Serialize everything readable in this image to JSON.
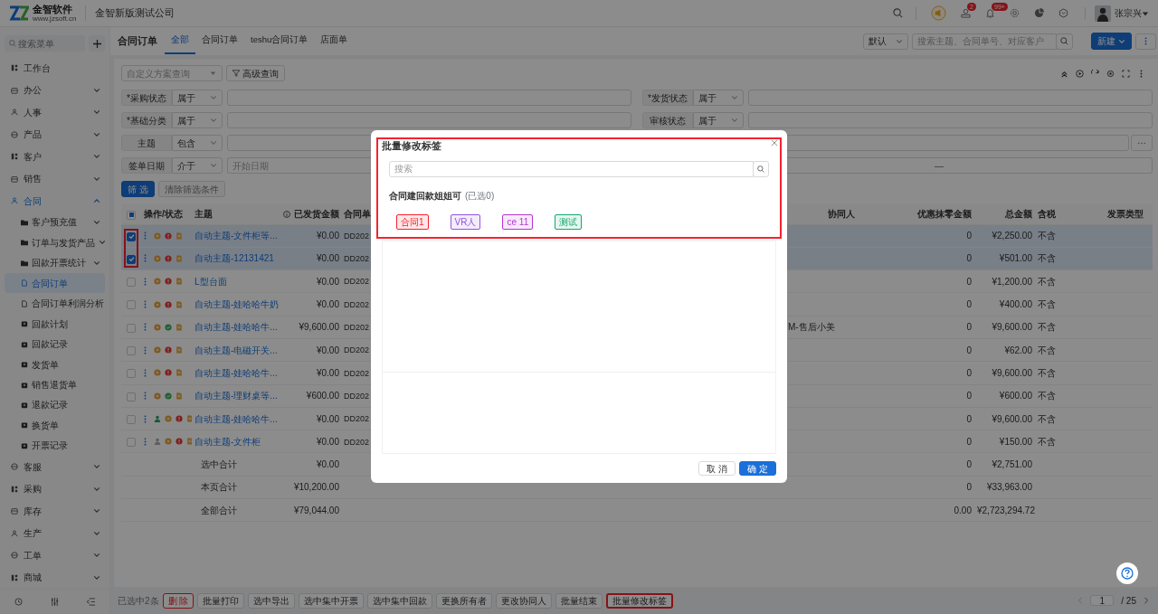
{
  "header": {
    "logo_name": "金智软件",
    "logo_url": "www.jzsoft.cn",
    "company": "金智新版测试公司",
    "badges": [
      "2",
      "99+"
    ],
    "user": "张宗兴"
  },
  "sidebar": {
    "search_placeholder": "搜索菜单",
    "items": [
      {
        "label": "工作台",
        "selected": false
      },
      {
        "label": "办公",
        "selected": false,
        "expanded": false
      },
      {
        "label": "人事",
        "selected": false,
        "expanded": false
      },
      {
        "label": "产品",
        "selected": false,
        "expanded": false
      },
      {
        "label": "客户",
        "selected": false,
        "expanded": false
      },
      {
        "label": "销售",
        "selected": false,
        "expanded": false
      },
      {
        "label": "合同",
        "selected": true,
        "expanded": true,
        "children": [
          {
            "label": "客户预充值",
            "selected": false,
            "expanded": false
          },
          {
            "label": "订单与发货产品",
            "selected": false,
            "expanded": false
          },
          {
            "label": "回款开票统计",
            "selected": false,
            "expanded": false
          },
          {
            "label": "合同订单",
            "selected": true
          },
          {
            "label": "合同订单利润分析",
            "selected": false
          },
          {
            "label": "回款计划",
            "selected": false
          },
          {
            "label": "回款记录",
            "selected": false
          },
          {
            "label": "发货单",
            "selected": false
          },
          {
            "label": "销售退货单",
            "selected": false
          },
          {
            "label": "退款记录",
            "selected": false
          },
          {
            "label": "换货单",
            "selected": false
          },
          {
            "label": "开票记录",
            "selected": false
          }
        ]
      },
      {
        "label": "客服",
        "selected": false,
        "expanded": false
      },
      {
        "label": "采购",
        "selected": false,
        "expanded": false
      },
      {
        "label": "库存",
        "selected": false,
        "expanded": false
      },
      {
        "label": "生产",
        "selected": false,
        "expanded": false
      },
      {
        "label": "工单",
        "selected": false,
        "expanded": false
      },
      {
        "label": "商城",
        "selected": false,
        "expanded": false
      }
    ]
  },
  "page": {
    "title": "合同订单",
    "tabs": [
      {
        "label": "全部",
        "selected": true
      },
      {
        "label": "合同订单",
        "selected": false
      },
      {
        "label": "teshu合同订单",
        "selected": false
      },
      {
        "label": "店面单",
        "selected": false
      }
    ],
    "sort": "默认",
    "search_placeholder": "搜索主题、合同单号、对应客户",
    "new_button": "新建"
  },
  "filter": {
    "scheme_placeholder": "自定义方案查询",
    "advanced": "高级查询",
    "fields": [
      {
        "kind": "half",
        "label": "*采购状态",
        "operator": "属于"
      },
      {
        "kind": "half",
        "label": "*发货状态",
        "operator": "属于"
      },
      {
        "kind": "half",
        "label": "*基础分类",
        "operator": "属于"
      },
      {
        "kind": "half",
        "label": "审核状态",
        "operator": "属于"
      },
      {
        "kind": "text",
        "label": "主题",
        "operator": "包含"
      },
      {
        "kind": "date_range",
        "label": "签单日期",
        "operator": "介于",
        "placeholder": "开始日期",
        "separator": "—"
      }
    ],
    "apply": "筛 选",
    "clear": "清除筛选条件"
  },
  "table": {
    "partially_selected": true,
    "selection_highlighted": true,
    "columns": [
      "操作/状态",
      "主题",
      "已发货金额",
      "合同单",
      "协同人",
      "优惠抹零金额",
      "总金额",
      "含税",
      "发票类型"
    ],
    "rows": [
      {
        "selected": true,
        "status_icons": [
          {
            "kind": "play"
          },
          {
            "kind": "alert"
          },
          {
            "kind": "doc"
          }
        ],
        "subject": "自动主题-文件柜等...",
        "shipped": "¥0.00",
        "order_no": "DD202",
        "discount": "0",
        "total": "¥2,250.00",
        "tax": "不含"
      },
      {
        "selected": true,
        "status_icons": [
          {
            "kind": "play"
          },
          {
            "kind": "alert"
          },
          {
            "kind": "doc"
          }
        ],
        "subject": "自动主题-12131421",
        "shipped": "¥0.00",
        "order_no": "DD202",
        "discount": "0",
        "total": "¥501.00",
        "tax": "不含"
      },
      {
        "selected": false,
        "status_icons": [
          {
            "kind": "play"
          },
          {
            "kind": "alert"
          },
          {
            "kind": "doc"
          }
        ],
        "subject": "L型台面",
        "shipped": "¥0.00",
        "order_no": "DD202",
        "discount": "0",
        "total": "¥1,200.00",
        "tax": "不含"
      },
      {
        "selected": false,
        "status_icons": [
          {
            "kind": "play"
          },
          {
            "kind": "alert"
          },
          {
            "kind": "doc"
          }
        ],
        "subject": "自动主题-娃哈哈牛奶",
        "shipped": "¥0.00",
        "order_no": "DD202",
        "discount": "0",
        "total": "¥400.00",
        "tax": "不含"
      },
      {
        "selected": false,
        "status_icons": [
          {
            "kind": "play"
          },
          {
            "kind": "check"
          },
          {
            "kind": "doc"
          }
        ],
        "subject": "自动主题-娃哈哈牛...",
        "shipped": "¥9,600.00",
        "order_no": "DD202",
        "collaborator": "M-售后小美",
        "discount": "0",
        "total": "¥9,600.00",
        "tax": "不含"
      },
      {
        "selected": false,
        "status_icons": [
          {
            "kind": "play"
          },
          {
            "kind": "alert"
          },
          {
            "kind": "doc"
          }
        ],
        "subject": "自动主题-电磁开关...",
        "shipped": "¥0.00",
        "order_no": "DD202",
        "discount": "0",
        "total": "¥62.00",
        "tax": "不含"
      },
      {
        "selected": false,
        "status_icons": [
          {
            "kind": "play"
          },
          {
            "kind": "alert"
          },
          {
            "kind": "doc"
          }
        ],
        "subject": "自动主题-娃哈哈牛...",
        "shipped": "¥0.00",
        "order_no": "DD202",
        "discount": "0",
        "total": "¥9,600.00",
        "tax": "不含"
      },
      {
        "selected": false,
        "status_icons": [
          {
            "kind": "play"
          },
          {
            "kind": "check"
          },
          {
            "kind": "doc"
          }
        ],
        "subject": "自动主题-理财桌等...",
        "shipped": "¥600.00",
        "order_no": "DD202",
        "discount": "0",
        "total": "¥600.00",
        "tax": "不含"
      },
      {
        "selected": false,
        "status_icons": [
          {
            "kind": "person_active"
          },
          {
            "kind": "play"
          },
          {
            "kind": "alert"
          },
          {
            "kind": "doc"
          }
        ],
        "subject": "自动主题-娃哈哈牛...",
        "shipped": "¥0.00",
        "order_no": "DD202",
        "discount": "0",
        "total": "¥9,600.00",
        "tax": "不含"
      },
      {
        "selected": false,
        "status_icons": [
          {
            "kind": "person"
          },
          {
            "kind": "play"
          },
          {
            "kind": "alert"
          },
          {
            "kind": "doc"
          }
        ],
        "subject": "自动主题-文件柜",
        "shipped": "¥0.00",
        "order_no": "DD202",
        "discount": "0",
        "total": "¥150.00",
        "tax": "不含"
      }
    ],
    "summary": [
      {
        "label": "选中合计",
        "shipped": "¥0.00",
        "discount": "0",
        "total": "¥2,751.00"
      },
      {
        "label": "本页合计",
        "shipped": "¥10,200.00",
        "discount": "0",
        "total": "¥33,963.00"
      },
      {
        "label": "全部合计",
        "shipped": "¥79,044.00",
        "discount": "0.00",
        "total": "¥2,723,294.72"
      }
    ]
  },
  "bulk_bar": {
    "selected_count": "已选中2条",
    "actions": [
      {
        "label": "删 除",
        "kind": "danger",
        "highlighted": false
      },
      {
        "label": "批量打印",
        "kind": "normal",
        "highlighted": false
      },
      {
        "label": "选中导出",
        "kind": "normal",
        "highlighted": false
      },
      {
        "label": "选中集中开票",
        "kind": "normal",
        "highlighted": false
      },
      {
        "label": "选中集中回款",
        "kind": "normal",
        "highlighted": false
      },
      {
        "label": "更换所有者",
        "kind": "normal",
        "highlighted": false
      },
      {
        "label": "更改协同人",
        "kind": "normal",
        "highlighted": false
      },
      {
        "label": "批量结束",
        "kind": "normal",
        "highlighted": false
      },
      {
        "label": "批量修改标签",
        "kind": "normal",
        "highlighted": true
      }
    ],
    "pagination": {
      "page": "1",
      "total": "/ 25"
    }
  },
  "modal": {
    "title": "批量修改标签",
    "highlighted": true,
    "search_placeholder": "搜索",
    "groups": [
      {
        "name": "合同建回款姐姐可",
        "count": "(已选0)",
        "tags": [
          {
            "label": "合同1",
            "color": "#f5222d",
            "selected": false
          },
          {
            "label": "VR人",
            "color": "#9254de",
            "selected": false
          },
          {
            "label": "ce 11",
            "color": "#b337d0",
            "selected": false
          },
          {
            "label": "测试",
            "color": "#13a86b",
            "selected": false
          }
        ]
      }
    ],
    "buttons": [
      {
        "label": "取 消",
        "kind": "secondary"
      },
      {
        "label": "确 定",
        "kind": "primary"
      }
    ]
  }
}
